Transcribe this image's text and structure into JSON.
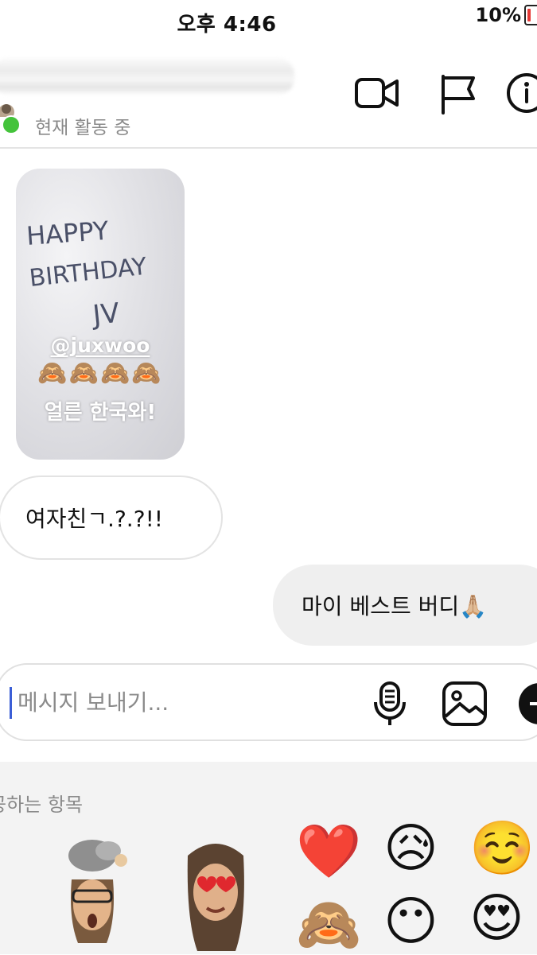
{
  "status_bar": {
    "time": "오후 4:46",
    "battery": "10%"
  },
  "header": {
    "active_status": "현재 활동 중"
  },
  "shared_image": {
    "handwriting_line1": "HAPPY",
    "handwriting_line2": "BIRTHDAY",
    "handwriting_line3": "JV",
    "mention": "@juxwoo",
    "emoji_row": "🙈🙈🙈🙈",
    "caption": "얼른 한국와!"
  },
  "messages": [
    {
      "direction": "received",
      "text": "여자친ㄱ.?.?!!"
    },
    {
      "direction": "sent",
      "text": "마이 베스트 버디🙏🏼"
    }
  ],
  "composer": {
    "placeholder": "메시지 보내기..."
  },
  "reactions_tray": {
    "title": "공하는 항목",
    "emojis": [
      "❤️",
      "😥",
      "☺️",
      "🙈",
      "😶",
      "😍"
    ]
  },
  "colors": {
    "active": "#44c33b",
    "battery_low": "#e53935",
    "caret": "#3b5ed6"
  }
}
